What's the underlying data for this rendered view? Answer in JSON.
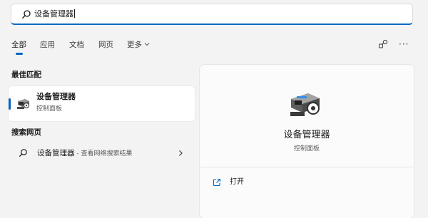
{
  "search": {
    "query": "设备管理器"
  },
  "tabs": [
    {
      "label": "全部"
    },
    {
      "label": "应用"
    },
    {
      "label": "文档"
    },
    {
      "label": "网页"
    },
    {
      "label": "更多"
    }
  ],
  "best_match": {
    "heading": "最佳匹配",
    "title": "设备管理器",
    "subtitle": "控制面板"
  },
  "web_search": {
    "heading": "搜索网页",
    "query": "设备管理器",
    "suffix": " - 查看网络搜索结果"
  },
  "details": {
    "title": "设备管理器",
    "subtitle": "控制面板",
    "actions": [
      {
        "label": "打开"
      }
    ]
  },
  "icons": {
    "search": "search-icon",
    "more_chevron": "chevron-down-icon",
    "share": "share-icon",
    "more_options": "ellipsis-icon",
    "device_manager": "device-manager-icon",
    "web_chevron": "chevron-right-icon",
    "open": "open-external-icon"
  },
  "colors": {
    "accent": "#0067c0"
  }
}
